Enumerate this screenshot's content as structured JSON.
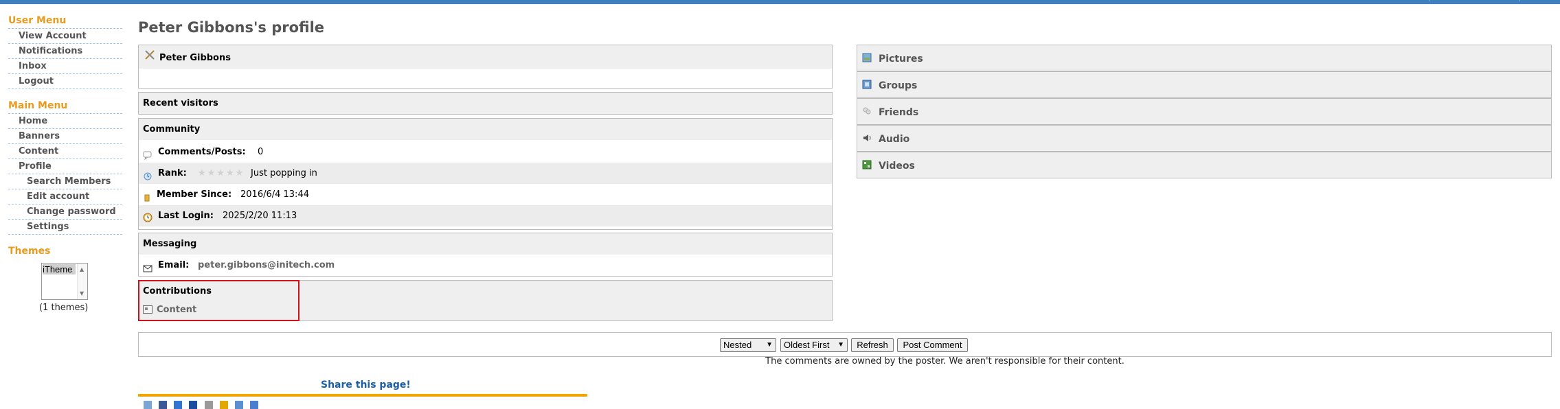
{
  "sidebar": {
    "user_menu_title": "User Menu",
    "user_menu": [
      "View Account",
      "Notifications",
      "Inbox",
      "Logout"
    ],
    "main_menu_title": "Main Menu",
    "main_menu": [
      "Home",
      "Banners",
      "Content",
      "Profile"
    ],
    "profile_submenu": [
      "Search Members",
      "Edit account",
      "Change password",
      "Settings"
    ],
    "themes_title": "Themes",
    "themes_selected": "iTheme",
    "themes_count": "(1 themes)"
  },
  "profile": {
    "page_title": "Peter Gibbons's profile",
    "name": "Peter Gibbons",
    "recent_visitors_title": "Recent visitors",
    "community_title": "Community",
    "comments_posts_label": "Comments/Posts:",
    "comments_posts_value": "0",
    "rank_label": "Rank:",
    "rank_stars": "★★★★★",
    "rank_value": "Just popping in",
    "member_since_label": "Member Since:",
    "member_since_value": "2016/6/4 13:44",
    "last_login_label": "Last Login:",
    "last_login_value": "2025/2/20 11:13",
    "messaging_title": "Messaging",
    "email_label": "Email:",
    "email_value": "peter.gibbons@initech.com",
    "contributions_title": "Contributions",
    "contributions_content": "Content"
  },
  "right_panels": [
    "Pictures",
    "Groups",
    "Friends",
    "Audio",
    "Videos"
  ],
  "comments": {
    "mode": "Nested",
    "order": "Oldest First",
    "refresh_label": "Refresh",
    "post_label": "Post Comment",
    "disclaimer": "The comments are owned by the poster. We aren't responsible for their content."
  },
  "share": {
    "title": "Share this page!"
  },
  "colors": {
    "accent_orange": "#e89b1e",
    "link_blue": "#1a5fa8",
    "highlight_red": "#d0111b"
  }
}
